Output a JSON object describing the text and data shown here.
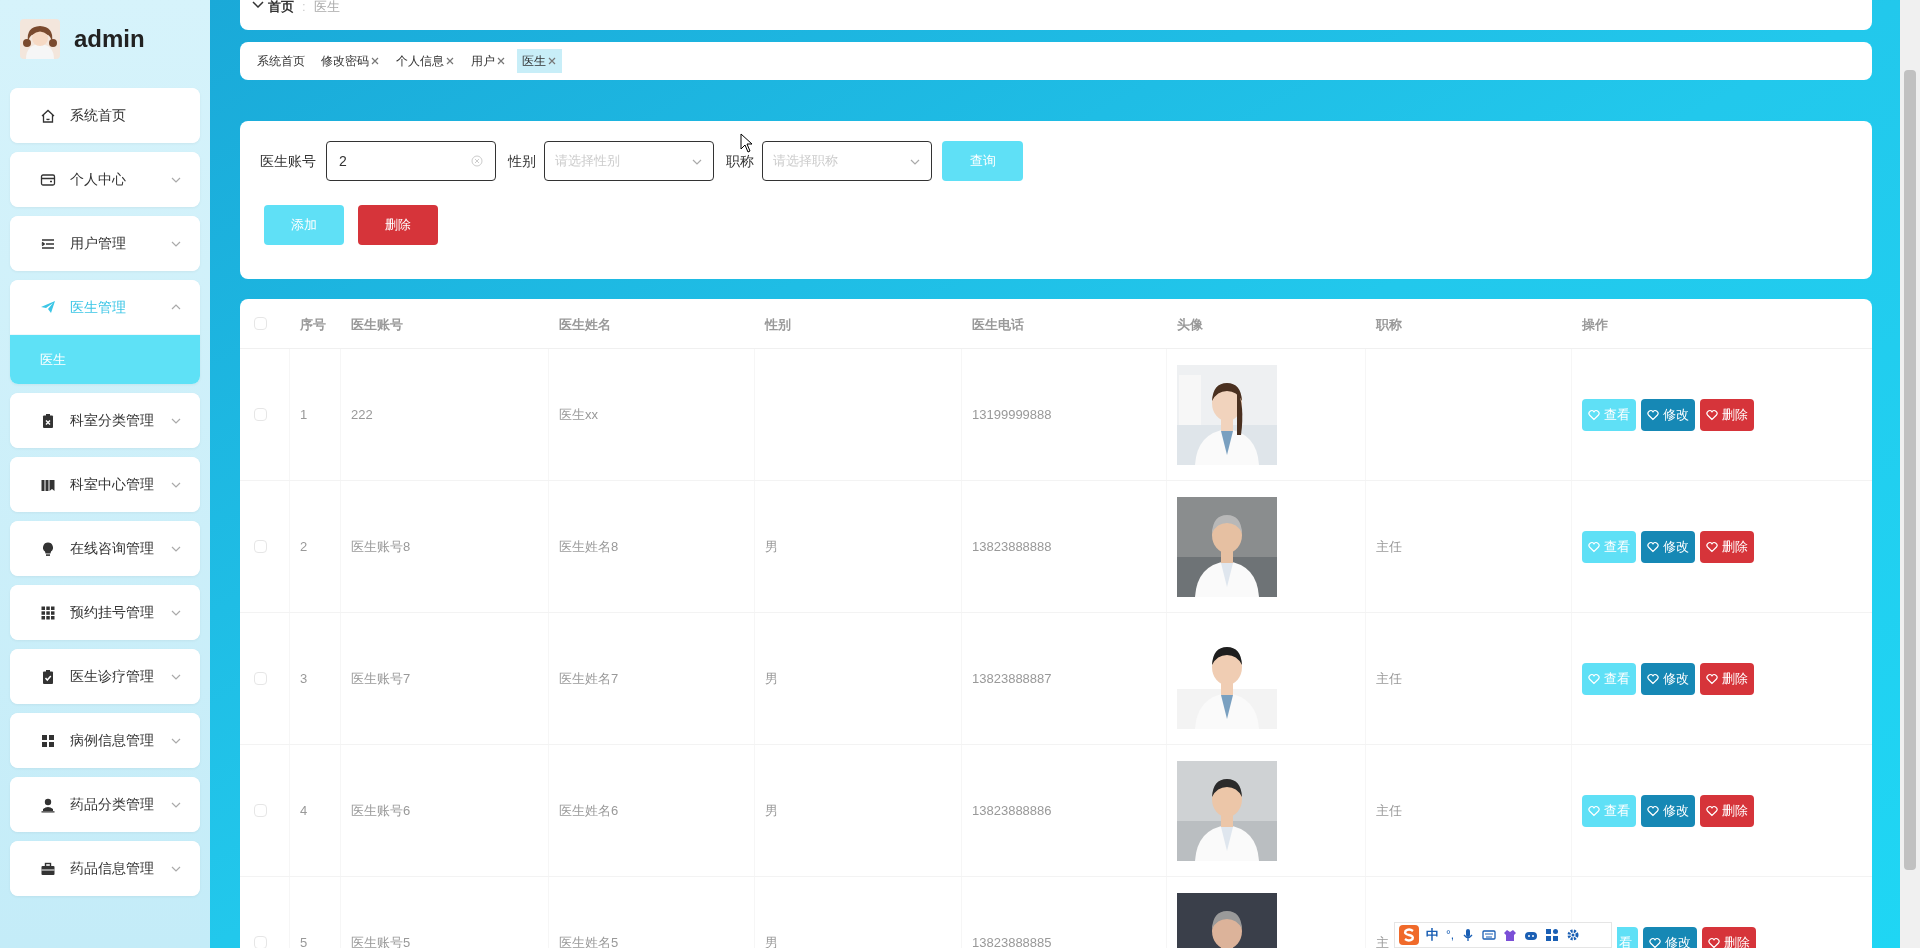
{
  "user": {
    "name": "admin"
  },
  "sidebar": {
    "items": [
      {
        "label": "系统首页",
        "kind": "home",
        "expandable": false,
        "selected": false
      },
      {
        "label": "个人中心",
        "kind": "card",
        "expandable": true,
        "expanded": false,
        "selected": false
      },
      {
        "label": "用户管理",
        "kind": "list",
        "expandable": true,
        "expanded": false,
        "selected": false
      },
      {
        "label": "医生管理",
        "kind": "plane",
        "expandable": true,
        "expanded": true,
        "selected": true,
        "children": [
          {
            "label": "医生",
            "selected": true
          }
        ]
      },
      {
        "label": "科室分类管理",
        "kind": "clipboard-x",
        "expandable": true,
        "expanded": false,
        "selected": false
      },
      {
        "label": "科室中心管理",
        "kind": "books",
        "expandable": true,
        "expanded": false,
        "selected": false
      },
      {
        "label": "在线咨询管理",
        "kind": "bulb",
        "expandable": true,
        "expanded": false,
        "selected": false
      },
      {
        "label": "预约挂号管理",
        "kind": "grid9",
        "expandable": true,
        "expanded": false,
        "selected": false
      },
      {
        "label": "医生诊疗管理",
        "kind": "clipboard-check",
        "expandable": true,
        "expanded": false,
        "selected": false
      },
      {
        "label": "病例信息管理",
        "kind": "grid4",
        "expandable": true,
        "expanded": false,
        "selected": false
      },
      {
        "label": "药品分类管理",
        "kind": "person",
        "expandable": true,
        "expanded": false,
        "selected": false
      },
      {
        "label": "药品信息管理",
        "kind": "briefcase",
        "expandable": true,
        "expanded": false,
        "selected": false
      }
    ]
  },
  "breadcrumb": {
    "items": [
      "首页",
      "医生"
    ],
    "separator": ":"
  },
  "tabs": [
    {
      "label": "系统首页",
      "closable": false,
      "selected": false
    },
    {
      "label": "修改密码",
      "closable": true,
      "selected": false
    },
    {
      "label": "个人信息",
      "closable": true,
      "selected": false
    },
    {
      "label": "用户",
      "closable": true,
      "selected": false
    },
    {
      "label": "医生",
      "closable": true,
      "selected": true
    }
  ],
  "search": {
    "fields": [
      {
        "label": "医生账号",
        "kind": "input",
        "value": "2"
      },
      {
        "label": "性别",
        "kind": "select",
        "placeholder": "请选择性别"
      },
      {
        "label": "职称",
        "kind": "select",
        "placeholder": "请选择职称"
      }
    ],
    "query_button": "查询",
    "add_button": "添加",
    "delete_button": "删除"
  },
  "table": {
    "select_all": {
      "checked": false
    },
    "columns": [
      "序号",
      "医生账号",
      "医生姓名",
      "性别",
      "医生电话",
      "头像",
      "职称",
      "操作"
    ],
    "rows": [
      {
        "checked": false,
        "index": "1",
        "account": "222",
        "name": "医生xx",
        "gender": "",
        "phone": "13199999888",
        "title": "",
        "actions": [
          {
            "kind": "view",
            "label": "查看"
          },
          {
            "kind": "edit",
            "label": "修改"
          },
          {
            "kind": "delete",
            "label": "删除"
          }
        ]
      },
      {
        "checked": false,
        "index": "2",
        "account": "医生账号8",
        "name": "医生姓名8",
        "gender": "男",
        "phone": "13823888888",
        "title": "主任",
        "actions": [
          {
            "kind": "view",
            "label": "查看"
          },
          {
            "kind": "edit",
            "label": "修改"
          },
          {
            "kind": "delete",
            "label": "删除"
          }
        ]
      },
      {
        "checked": false,
        "index": "3",
        "account": "医生账号7",
        "name": "医生姓名7",
        "gender": "男",
        "phone": "13823888887",
        "title": "主任",
        "actions": [
          {
            "kind": "view",
            "label": "查看"
          },
          {
            "kind": "edit",
            "label": "修改"
          },
          {
            "kind": "delete",
            "label": "删除"
          }
        ]
      },
      {
        "checked": false,
        "index": "4",
        "account": "医生账号6",
        "name": "医生姓名6",
        "gender": "男",
        "phone": "13823888886",
        "title": "主任",
        "actions": [
          {
            "kind": "view",
            "label": "查看"
          },
          {
            "kind": "edit",
            "label": "修改"
          },
          {
            "kind": "delete",
            "label": "删除"
          }
        ]
      },
      {
        "checked": false,
        "index": "5",
        "account": "医生账号5",
        "name": "医生姓名5",
        "gender": "男",
        "phone": "13823888885",
        "title": "主",
        "actions": [
          {
            "kind": "view",
            "label": "看",
            "covered": true
          },
          {
            "kind": "edit",
            "label": "修改"
          },
          {
            "kind": "delete",
            "label": "删除"
          }
        ]
      }
    ]
  },
  "ime_toolbar": {
    "labels": [
      "中",
      "°,"
    ]
  }
}
